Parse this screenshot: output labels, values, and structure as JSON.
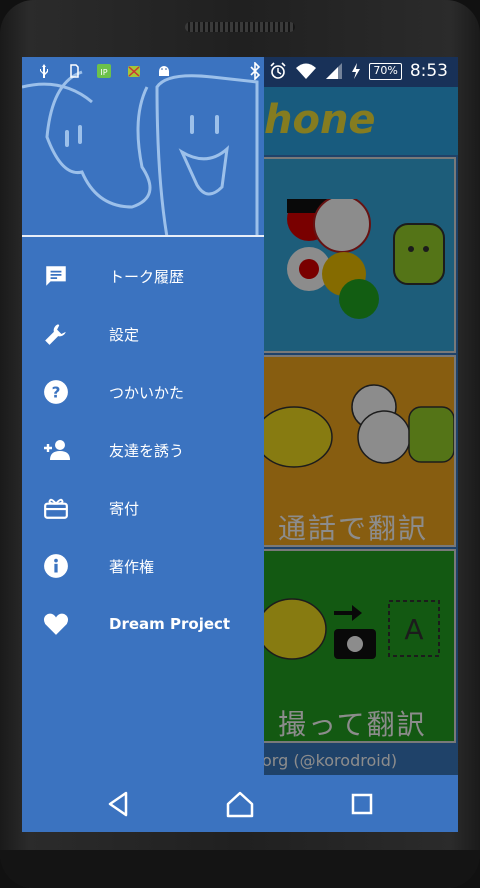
{
  "status_bar": {
    "icons": [
      "usb-icon",
      "sim-icon",
      "app-ip-icon",
      "debug-icon",
      "android-icon",
      "bluetooth-icon",
      "alarm-icon",
      "wifi-icon",
      "signal-icon",
      "charging-icon"
    ],
    "battery": "70%",
    "time": "8:53"
  },
  "background_app": {
    "title": "hone",
    "panels": [
      {
        "label": ""
      },
      {
        "label": "通話で翻訳"
      },
      {
        "label": "撮って翻訳"
      }
    ],
    "credit": "org (@korodroid)"
  },
  "drawer": {
    "items": [
      {
        "label": "トーク履歴",
        "icon": "chat-icon"
      },
      {
        "label": "設定",
        "icon": "wrench-icon"
      },
      {
        "label": "つかいかた",
        "icon": "help-icon"
      },
      {
        "label": "友達を誘う",
        "icon": "add-person-icon"
      },
      {
        "label": "寄付",
        "icon": "gift-icon"
      },
      {
        "label": "著作権",
        "icon": "info-icon"
      },
      {
        "label": "Dream Project",
        "icon": "heart-icon"
      }
    ]
  },
  "nav_bar": {
    "buttons": [
      "back-icon",
      "home-icon",
      "recents-icon"
    ]
  },
  "colors": {
    "drawer": "#3b73c0",
    "header_blue": "#2da6e6",
    "panel_orange": "#f6a91e",
    "panel_green": "#23a321"
  }
}
